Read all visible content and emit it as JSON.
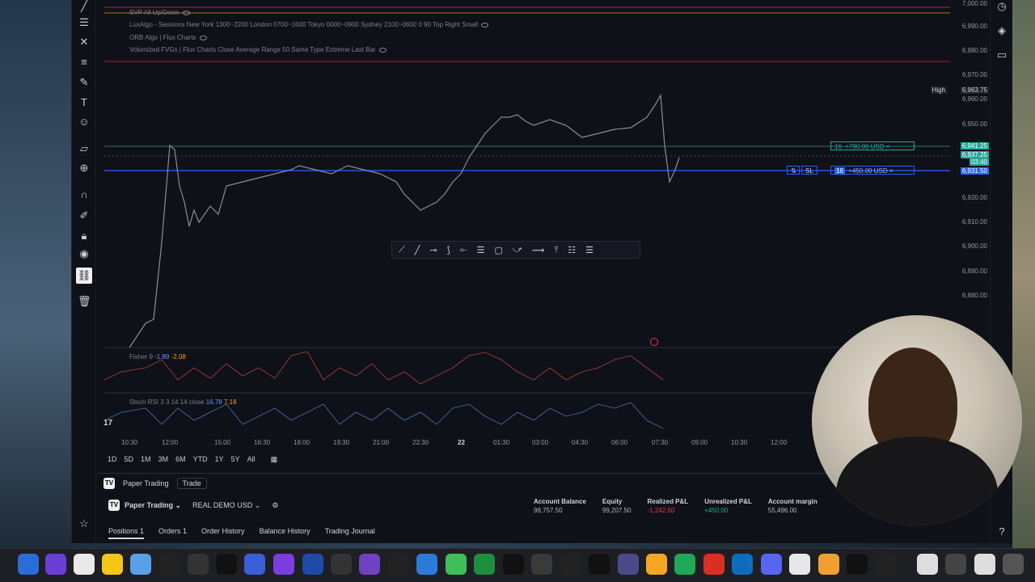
{
  "indicators": {
    "svp": "SVP All Up/Down",
    "luxalgo": "LuxAlgo - Sessions New York 1300~2200 London 0700~1600 Tokyo 0000~0900 Sydney 2100~0600 0 90 Top Right Small",
    "orb": "ORB Algo | Flux Charts",
    "fvg": "Volumized FVGs | Flux Charts Close Average Range 50 Same Type Extreme Last Bar",
    "fisher": "Fisher 9",
    "fisher_v1": "-1.89",
    "fisher_v2": "-2.08",
    "stoch": "Stoch RSI 3 3 14 14 close",
    "stoch_v1": "16.78",
    "stoch_v2": "7.18"
  },
  "price_scale": [
    "7,000.00",
    "6,990.00",
    "6,980.00",
    "6,970.00",
    "6,960.00",
    "6,950.00",
    "6,940.00",
    "6,930.00",
    "6,920.00",
    "6,910.00",
    "6,900.00",
    "6,890.00",
    "6,880.00"
  ],
  "price_tags": {
    "high_label": "High",
    "high": "6,963.75",
    "green": "6,941.25",
    "green2": "6,937.25",
    "green3": "03:40",
    "blue": "6,931.50"
  },
  "positions": {
    "tp_qty": "16",
    "tp_text": "+790.00 USD",
    "sl_label": "SL",
    "entry_qty": "16",
    "entry_text": "+450.00 USD"
  },
  "time_axis": [
    "10:30",
    "12:00",
    "15:00",
    "16:30",
    "18:00",
    "19:30",
    "21:00",
    "22:30",
    "22",
    "01:30",
    "03:00",
    "04:30",
    "06:00",
    "07:30",
    "09:00",
    "10:30",
    "12:00"
  ],
  "ranges": [
    "1D",
    "5D",
    "1M",
    "3M",
    "6M",
    "YTD",
    "1Y",
    "5Y",
    "All"
  ],
  "panel": {
    "title": "Paper Trading",
    "trade_button": "Trade",
    "broker": "Paper Trading",
    "account": "REAL DEMO USD",
    "metrics": [
      {
        "title": "Account Balance",
        "value": "98,757.50",
        "color": "#b2b5be"
      },
      {
        "title": "Equity",
        "value": "99,207.50",
        "color": "#b2b5be"
      },
      {
        "title": "Realized P&L",
        "value": "-1,242.50",
        "color": "#f23645"
      },
      {
        "title": "Unrealized P&L",
        "value": "+450.00",
        "color": "#22ab94"
      },
      {
        "title": "Account margin",
        "value": "55,496.00",
        "color": "#b2b5be"
      }
    ],
    "tabs": [
      "Positions 1",
      "Orders 1",
      "Order History",
      "Balance History",
      "Trading Journal"
    ]
  },
  "colors": {
    "up": "#26a69a",
    "down": "#ef5350",
    "blue_line": "#2962ff",
    "green_line": "#26a69a",
    "red_line": "#f23645"
  }
}
